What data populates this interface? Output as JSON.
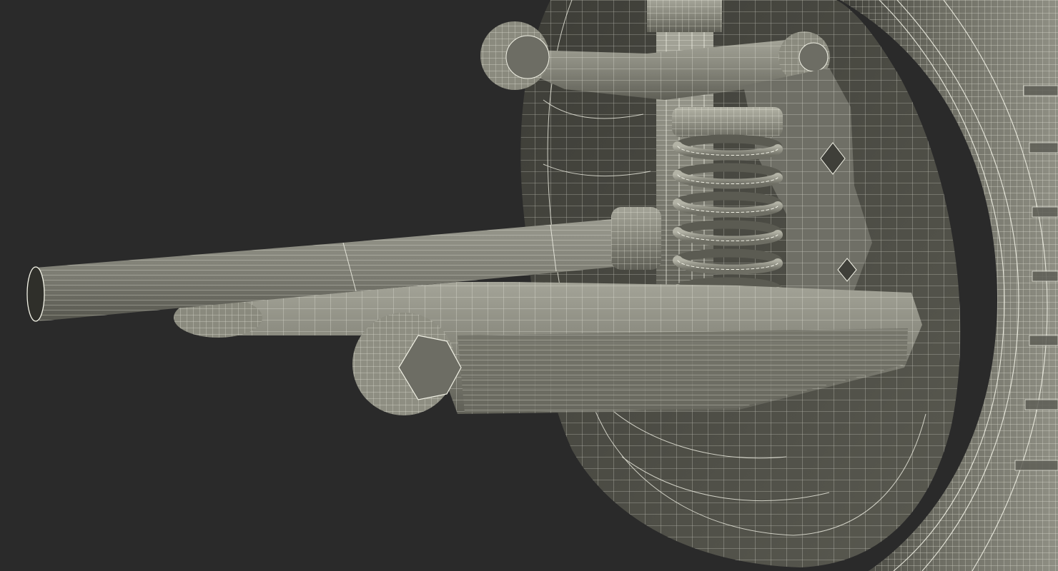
{
  "viewport": {
    "background": "#2a2a2a"
  },
  "render": {
    "style": "wireframe-shaded",
    "surface_color": "#8a8a7e",
    "surface_dark": "#4f4f47",
    "wire_color": "#f2f2e6"
  },
  "model": {
    "subject": "front-suspension-assembly",
    "parts": [
      "tire-icon",
      "wheel-rim-icon",
      "axle-shaft-icon",
      "coil-spring-icon",
      "shock-absorber-icon",
      "upper-control-arm-icon",
      "lower-control-arm-icon",
      "steering-knuckle-icon"
    ]
  }
}
